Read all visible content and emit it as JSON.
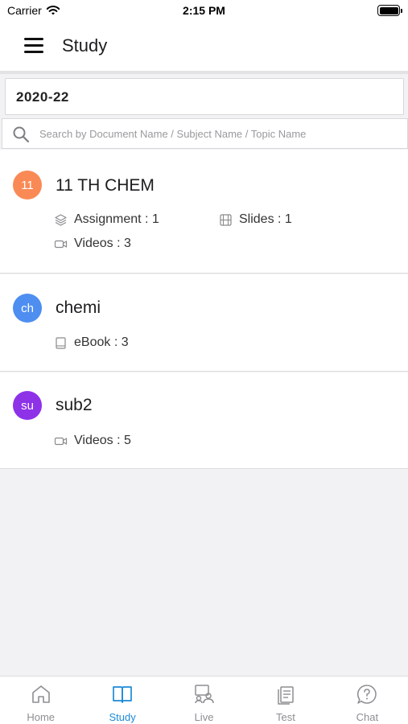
{
  "status_bar": {
    "carrier": "Carrier",
    "time": "2:15 PM"
  },
  "header": {
    "title": "Study"
  },
  "year_selector": {
    "value": "2020-22"
  },
  "search": {
    "placeholder": "Search by Document Name / Subject Name / Topic Name",
    "value": ""
  },
  "subjects": [
    {
      "avatar": "11",
      "color": "#f98a56",
      "name": "11 TH CHEM",
      "assignment": "Assignment : 1",
      "slides": "Slides : 1",
      "videos": "Videos : 3"
    },
    {
      "avatar": "ch",
      "color": "#4d8ef0",
      "name": "chemi",
      "ebook": "eBook : 3"
    },
    {
      "avatar": "su",
      "color": "#8e32e8",
      "name": "sub2",
      "videos": "Videos : 5"
    }
  ],
  "tabs": [
    {
      "label": "Home",
      "icon": "home-icon",
      "active": false
    },
    {
      "label": "Study",
      "icon": "book-icon",
      "active": true
    },
    {
      "label": "Live",
      "icon": "live-class-icon",
      "active": false
    },
    {
      "label": "Test",
      "icon": "test-icon",
      "active": false
    },
    {
      "label": "Chat",
      "icon": "chat-icon",
      "active": false
    }
  ],
  "colors": {
    "accent": "#1b8ad8",
    "inactive_tab": "#8e8e93"
  }
}
